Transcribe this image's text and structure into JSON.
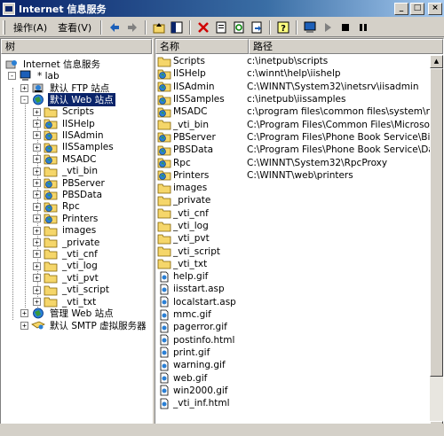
{
  "window": {
    "title": "Internet 信息服务"
  },
  "menu": {
    "action": "操作(A)",
    "view": "查看(V)"
  },
  "tree": {
    "header": "树",
    "items": [
      {
        "label": "Internet 信息服务",
        "icon": "iis-root-icon"
      },
      {
        "label": "* lab",
        "icon": "computer-icon"
      },
      {
        "label": "默认 FTP 站点",
        "icon": "ftp-site-icon"
      },
      {
        "label": "默认 Web 站点",
        "icon": "web-site-icon"
      },
      {
        "label": "Scripts",
        "icon": "folder-icon"
      },
      {
        "label": "IISHelp",
        "icon": "globe-app-icon"
      },
      {
        "label": "IISAdmin",
        "icon": "globe-app-icon"
      },
      {
        "label": "IISSamples",
        "icon": "globe-app-icon"
      },
      {
        "label": "MSADC",
        "icon": "globe-app-icon"
      },
      {
        "label": "_vti_bin",
        "icon": "folder-icon"
      },
      {
        "label": "PBServer",
        "icon": "globe-app-icon"
      },
      {
        "label": "PBSData",
        "icon": "globe-app-icon"
      },
      {
        "label": "Rpc",
        "icon": "globe-app-icon"
      },
      {
        "label": "Printers",
        "icon": "globe-app-icon"
      },
      {
        "label": "images",
        "icon": "folder-icon"
      },
      {
        "label": "_private",
        "icon": "folder-icon"
      },
      {
        "label": "_vti_cnf",
        "icon": "folder-icon"
      },
      {
        "label": "_vti_log",
        "icon": "folder-icon"
      },
      {
        "label": "_vti_pvt",
        "icon": "folder-icon"
      },
      {
        "label": "_vti_script",
        "icon": "folder-icon"
      },
      {
        "label": "_vti_txt",
        "icon": "folder-icon"
      },
      {
        "label": "管理 Web 站点",
        "icon": "web-site-icon"
      },
      {
        "label": "默认 SMTP 虚拟服务器",
        "icon": "smtp-icon"
      }
    ]
  },
  "list": {
    "columns": [
      "名称",
      "路径"
    ],
    "rows": [
      {
        "name": "Scripts",
        "path": "c:\\inetpub\\scripts",
        "icon": "folder-icon"
      },
      {
        "name": "IISHelp",
        "path": "c:\\winnt\\help\\iishelp",
        "icon": "globe-app-icon"
      },
      {
        "name": "IISAdmin",
        "path": "C:\\WINNT\\System32\\inetsrv\\iisadmin",
        "icon": "globe-app-icon"
      },
      {
        "name": "IISSamples",
        "path": "c:\\inetpub\\iissamples",
        "icon": "globe-app-icon"
      },
      {
        "name": "MSADC",
        "path": "c:\\program files\\common files\\system\\msadc",
        "icon": "globe-app-icon"
      },
      {
        "name": "_vti_bin",
        "path": "C:\\Program Files\\Common Files\\Microsoft Shared\\W",
        "icon": "folder-icon"
      },
      {
        "name": "PBServer",
        "path": "C:\\Program Files\\Phone Book Service\\Bin",
        "icon": "globe-app-icon"
      },
      {
        "name": "PBSData",
        "path": "C:\\Program Files\\Phone Book Service\\Data",
        "icon": "globe-app-icon"
      },
      {
        "name": "Rpc",
        "path": "C:\\WINNT\\System32\\RpcProxy",
        "icon": "globe-app-icon"
      },
      {
        "name": "Printers",
        "path": "C:\\WINNT\\web\\printers",
        "icon": "globe-app-icon"
      },
      {
        "name": "images",
        "path": "",
        "icon": "folder-icon"
      },
      {
        "name": "_private",
        "path": "",
        "icon": "folder-icon"
      },
      {
        "name": "_vti_cnf",
        "path": "",
        "icon": "folder-icon"
      },
      {
        "name": "_vti_log",
        "path": "",
        "icon": "folder-icon"
      },
      {
        "name": "_vti_pvt",
        "path": "",
        "icon": "folder-icon"
      },
      {
        "name": "_vti_script",
        "path": "",
        "icon": "folder-icon"
      },
      {
        "name": "_vti_txt",
        "path": "",
        "icon": "folder-icon"
      },
      {
        "name": "help.gif",
        "path": "",
        "icon": "file-icon"
      },
      {
        "name": "iisstart.asp",
        "path": "",
        "icon": "file-icon"
      },
      {
        "name": "localstart.asp",
        "path": "",
        "icon": "file-icon"
      },
      {
        "name": "mmc.gif",
        "path": "",
        "icon": "file-icon"
      },
      {
        "name": "pagerror.gif",
        "path": "",
        "icon": "file-icon"
      },
      {
        "name": "postinfo.html",
        "path": "",
        "icon": "file-icon"
      },
      {
        "name": "print.gif",
        "path": "",
        "icon": "file-icon"
      },
      {
        "name": "warning.gif",
        "path": "",
        "icon": "file-icon"
      },
      {
        "name": "web.gif",
        "path": "",
        "icon": "file-icon"
      },
      {
        "name": "win2000.gif",
        "path": "",
        "icon": "file-icon"
      },
      {
        "name": "_vti_inf.html",
        "path": "",
        "icon": "file-icon"
      }
    ]
  },
  "colors": {
    "titlebar": "#0a246a",
    "selection": "#0a246a",
    "folder": "#f5d66a",
    "chrome": "#d4d0c8"
  }
}
